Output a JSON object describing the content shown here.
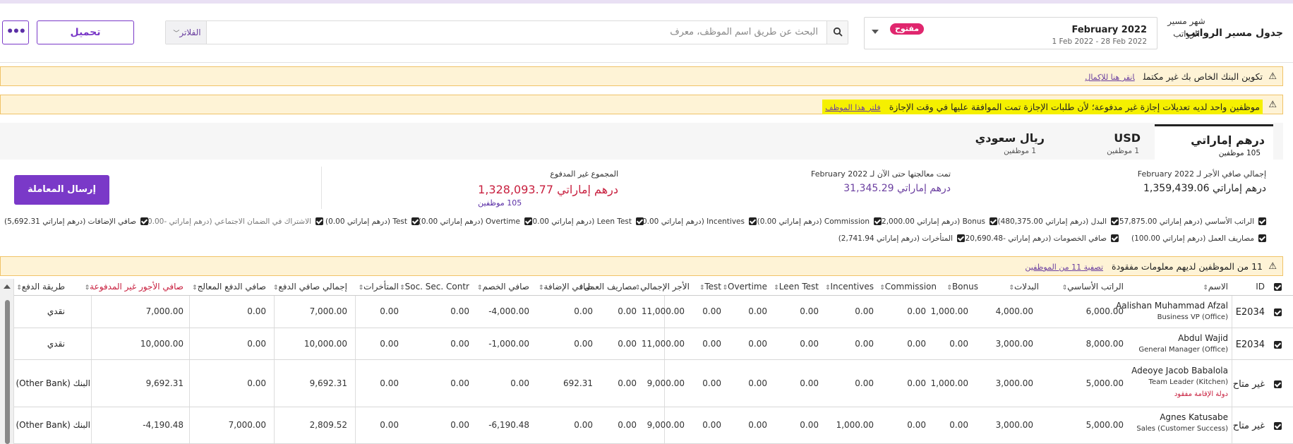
{
  "header": {
    "title": "جدول مسير الرواتب",
    "month_label": "شهر مسير الرواتب",
    "month_name": "February 2022",
    "month_range": "1 Feb 2022 - 28 Feb 2022",
    "status_badge": "مفتوح",
    "search_placeholder": "البحث عن طريق اسم الموظف، معرف",
    "filters_label": "الفلاتر",
    "upload_label": "تحميل",
    "more_label": "•••"
  },
  "banners": {
    "bank": {
      "text": "تكوين البنك الخاص بك غير مكتمل",
      "link": "انقر هنا للإكمال"
    },
    "leave": {
      "text": "موظفين واحد لديه تعديلات إجازة غير مدفوعة؛ لأن طلبات الإجازة تمت الموافقة عليها في وقت الإجازة",
      "link": "فلتر هذا الموظف"
    },
    "missing": {
      "count": "11",
      "text": "من الموظفين لديهم معلومات مفقودة",
      "link": "تصفية 11 من الموظفين"
    }
  },
  "tabs": [
    {
      "name": "درهم إماراتي",
      "count": "105 موظفين"
    },
    {
      "name": "USD",
      "count": "1 موظفين"
    },
    {
      "name": "ريال سعودي",
      "count": "1 موظفين"
    }
  ],
  "summary": {
    "net": {
      "label": "إجمالي صافي الأجر لـ February 2022",
      "value": "درهم إماراتي 1,359,439.06"
    },
    "processed": {
      "label": "تمت معالجتها حتى الآن لـ February 2022",
      "value": "درهم إماراتي 31,345.29"
    },
    "unpaid": {
      "label": "المجموع غير المدفوع",
      "value": "درهم إماراتي 1,328,093.77",
      "count": "105 موظفين"
    },
    "send_label": "إرسال المعاملة"
  },
  "checkboxes_row1": [
    "الراتب الأساسي (درهم إماراتي 857,875.00)",
    "البدل (درهم إماراتي 480,375.00)",
    "Bonus (درهم إماراتي 2,000.00)",
    "Commission (درهم إماراتي 0.00)",
    "Incentives (درهم إماراتي 0.00)",
    "Leen Test (درهم إماراتي 0.00)",
    "Overtime (درهم إماراتي 0.00)",
    "Test (درهم إماراتي 0.00)",
    "الاشتراك في الضمان الاجتماعي (درهم إماراتي -0.00)",
    "صافي الإضافات (درهم إماراتي 5,692.31)"
  ],
  "checkboxes_row2": [
    "مصاريف العمل (درهم إماراتي 100.00)",
    "صافي الخصومات (درهم إماراتي -20,690.48)",
    "المتأخرات (درهم إماراتي 2,741.94)"
  ],
  "table": {
    "headers": {
      "id": "ID",
      "name": "الاسم",
      "basic": "الراتب الأساسي",
      "allowances": "البدلات",
      "bonus": "Bonus",
      "commission": "Commission",
      "incentives": "Incentives",
      "leen": "Leen Test",
      "overtime": "Overtime",
      "test": "Test",
      "gross": "الأجر الإجمالي",
      "expenses": "مصاريف العمل",
      "additions": "صافي الإضافة",
      "deductions": "صافي الخصم",
      "soc": "Soc. Sec. Contr",
      "arrears": "المتأخرات",
      "netpay": "إجمالي صافي الدفع",
      "processed": "صافي الدفع المعالج",
      "unpaid": "صافي الأجور غير المدفوعة",
      "method": "طريقة الدفع"
    },
    "rows": [
      {
        "id": "E2034",
        "name": "Aalishan Muhammad Afzal",
        "role": "Business VP (Office)",
        "warn": "",
        "basic": "6,000.00",
        "allowances": "4,000.00",
        "bonus": "1,000.00",
        "commission": "0.00",
        "incentives": "0.00",
        "leen": "0.00",
        "overtime": "0.00",
        "test": "0.00",
        "gross": "11,000.00",
        "expenses": "0.00",
        "additions": "0.00",
        "deductions": "-4,000.00",
        "soc": "0.00",
        "arrears": "0.00",
        "netpay": "7,000.00",
        "processed": "0.00",
        "unpaid": "7,000.00",
        "method": "نقدي"
      },
      {
        "id": "E2034",
        "name": "Abdul Wajid",
        "role": "General Manager (Office)",
        "warn": "",
        "basic": "8,000.00",
        "allowances": "3,000.00",
        "bonus": "0.00",
        "commission": "0.00",
        "incentives": "0.00",
        "leen": "0.00",
        "overtime": "0.00",
        "test": "0.00",
        "gross": "11,000.00",
        "expenses": "0.00",
        "additions": "0.00",
        "deductions": "-1,000.00",
        "soc": "0.00",
        "arrears": "0.00",
        "netpay": "10,000.00",
        "processed": "0.00",
        "unpaid": "10,000.00",
        "method": "نقدي"
      },
      {
        "id": "غير متاح",
        "name": "Adeoye Jacob Babalola",
        "role": "Team Leader (Kitchen)",
        "warn": "دولة الإقامة مفقود",
        "basic": "5,000.00",
        "allowances": "3,000.00",
        "bonus": "1,000.00",
        "commission": "0.00",
        "incentives": "0.00",
        "leen": "0.00",
        "overtime": "0.00",
        "test": "0.00",
        "gross": "9,000.00",
        "expenses": "0.00",
        "additions": "692.31",
        "deductions": "0.00",
        "soc": "0.00",
        "arrears": "0.00",
        "netpay": "9,692.31",
        "processed": "0.00",
        "unpaid": "9,692.31",
        "method": "البنك (Other Bank)"
      },
      {
        "id": "غير متاح",
        "name": "Agnes Katusabe",
        "role": "Sales (Customer Success)",
        "warn": "",
        "basic": "5,000.00",
        "allowances": "3,000.00",
        "bonus": "0.00",
        "commission": "0.00",
        "incentives": "1,000.00",
        "leen": "0.00",
        "overtime": "0.00",
        "test": "0.00",
        "gross": "9,000.00",
        "expenses": "0.00",
        "additions": "0.00",
        "deductions": "-6,190.48",
        "soc": "0.00",
        "arrears": "0.00",
        "netpay": "2,809.52",
        "processed": "7,000.00",
        "unpaid": "-4,190.48",
        "method": "البنك (Other Bank)"
      }
    ]
  }
}
